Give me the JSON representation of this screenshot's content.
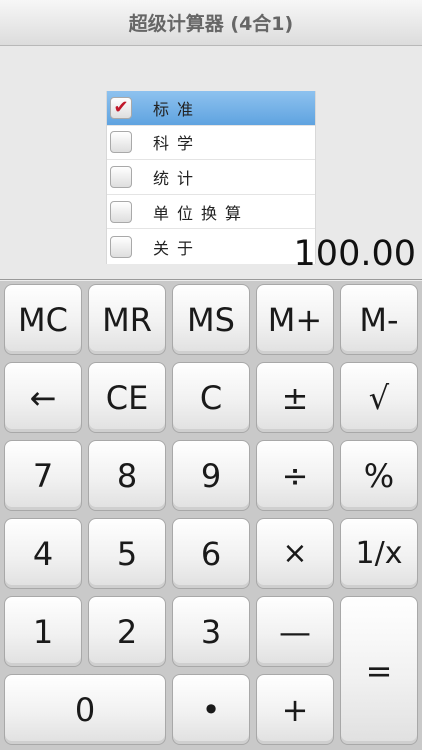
{
  "app": {
    "title": "超级计算器 (4合1)"
  },
  "mode_menu": {
    "items": [
      {
        "label": "标准",
        "checked": true
      },
      {
        "label": "科学",
        "checked": false
      },
      {
        "label": "统计",
        "checked": false
      },
      {
        "label": "单位换算",
        "checked": false
      },
      {
        "label": "关于",
        "checked": false
      }
    ],
    "check_glyph": "✔"
  },
  "display": {
    "value": "100.00"
  },
  "keys": {
    "mc": "MC",
    "mr": "MR",
    "ms": "MS",
    "mplus": "M+",
    "mminus": "M-",
    "backspace": "←",
    "ce": "CE",
    "c": "C",
    "plusminus": "±",
    "sqrt": "√",
    "n7": "7",
    "n8": "8",
    "n9": "9",
    "divide": "÷",
    "percent": "%",
    "n4": "4",
    "n5": "5",
    "n6": "6",
    "multiply": "×",
    "reciprocal": "1/x",
    "n1": "1",
    "n2": "2",
    "n3": "3",
    "minus": "—",
    "equals": "=",
    "n0": "0",
    "dot": "•",
    "plus": "+"
  },
  "colors": {
    "check_mark": "#c0182a",
    "selected_row": "#5fa3e0"
  }
}
